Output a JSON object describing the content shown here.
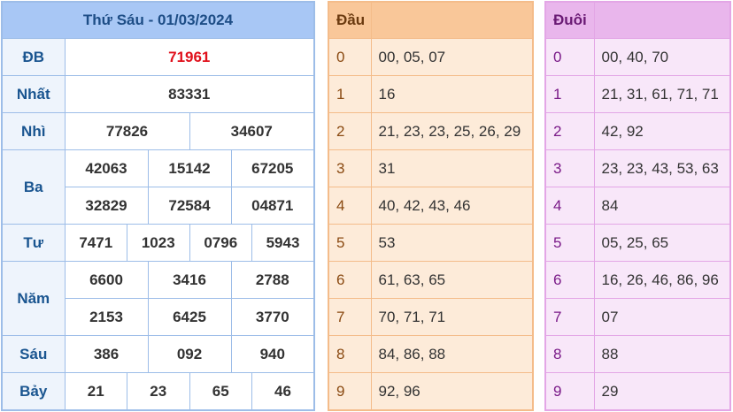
{
  "results": {
    "title": "Thứ Sáu - 01/03/2024",
    "db": {
      "label": "ĐB",
      "values": [
        "71961"
      ]
    },
    "nhat": {
      "label": "Nhất",
      "values": [
        "83331"
      ]
    },
    "nhi": {
      "label": "Nhì",
      "values": [
        "77826",
        "34607"
      ]
    },
    "ba": {
      "label": "Ba",
      "values": [
        "42063",
        "15142",
        "67205",
        "32829",
        "72584",
        "04871"
      ]
    },
    "tu": {
      "label": "Tư",
      "values": [
        "7471",
        "1023",
        "0796",
        "5943"
      ]
    },
    "nam": {
      "label": "Năm",
      "values": [
        "6600",
        "3416",
        "2788",
        "2153",
        "6425",
        "3770"
      ]
    },
    "sau": {
      "label": "Sáu",
      "values": [
        "386",
        "092",
        "940"
      ]
    },
    "bay": {
      "label": "Bảy",
      "values": [
        "21",
        "23",
        "65",
        "46"
      ]
    }
  },
  "dau": {
    "header": "Đầu",
    "rows": [
      {
        "idx": "0",
        "list": "00, 05, 07"
      },
      {
        "idx": "1",
        "list": "16"
      },
      {
        "idx": "2",
        "list": "21, 23, 23, 25, 26, 29"
      },
      {
        "idx": "3",
        "list": "31"
      },
      {
        "idx": "4",
        "list": "40, 42, 43, 46"
      },
      {
        "idx": "5",
        "list": "53"
      },
      {
        "idx": "6",
        "list": "61, 63, 65"
      },
      {
        "idx": "7",
        "list": "70, 71, 71"
      },
      {
        "idx": "8",
        "list": "84, 86, 88"
      },
      {
        "idx": "9",
        "list": "92, 96"
      }
    ]
  },
  "duoi": {
    "header": "Đuôi",
    "rows": [
      {
        "idx": "0",
        "list": "00, 40, 70"
      },
      {
        "idx": "1",
        "list": "21, 31, 61, 71, 71"
      },
      {
        "idx": "2",
        "list": "42, 92"
      },
      {
        "idx": "3",
        "list": "23, 23, 43, 53, 63"
      },
      {
        "idx": "4",
        "list": "84"
      },
      {
        "idx": "5",
        "list": "05, 25, 65"
      },
      {
        "idx": "6",
        "list": "16, 26, 46, 86, 96"
      },
      {
        "idx": "7",
        "list": "07"
      },
      {
        "idx": "8",
        "list": "88"
      },
      {
        "idx": "9",
        "list": "29"
      }
    ]
  },
  "colors": {
    "special_prize": "#e0101b",
    "results_accent": "#a8c7f5",
    "dau_accent": "#f9c799",
    "duoi_accent": "#e9b6ec"
  }
}
